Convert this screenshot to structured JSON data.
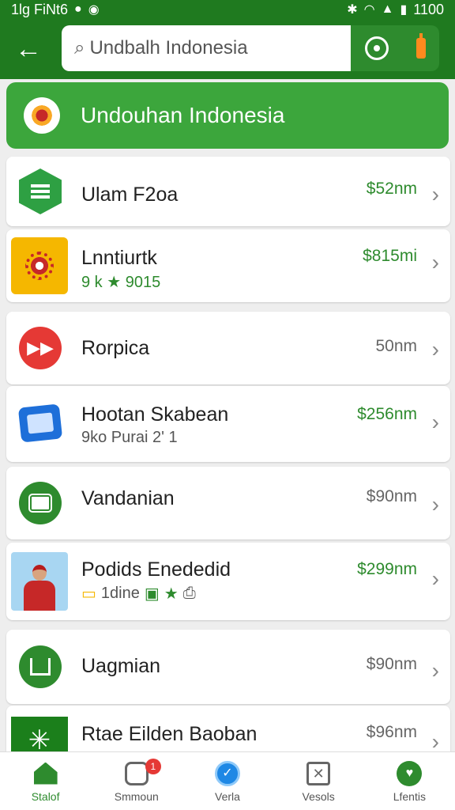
{
  "status_bar": {
    "left_text": "1lg FiNt6",
    "right_text": "1100",
    "icons": [
      "notification-icon",
      "chat-icon",
      "bluetooth-icon",
      "wifi-icon",
      "signal-icon",
      "battery-icon"
    ]
  },
  "app_bar": {
    "back_icon": "arrow-left-icon",
    "search_value": "Undbalh Indonesia",
    "search_icon": "magnifier-icon",
    "actions": [
      "zoom-icon",
      "bolt-icon"
    ]
  },
  "banner": {
    "title": "Undouhan Indonesia",
    "emblem": "garuda-emblem-icon"
  },
  "items": [
    {
      "name": "Ulam F2oa",
      "price": "$52nm",
      "price_color": "green",
      "icon": "list-hexagon-icon"
    },
    {
      "name": "Lnntiurtk",
      "sub": "9 k ★ 9015",
      "price": "$815mi",
      "price_color": "green",
      "icon": "gear-emblem-icon"
    },
    {
      "name": "Rorpica",
      "price": "50nm",
      "price_color": "gray",
      "icon": "play-icon"
    },
    {
      "name": "Hootan Skabean",
      "sub": "9ko Purai 2' 1",
      "price": "$256nm",
      "price_color": "green",
      "icon": "document-icon"
    },
    {
      "name": "Vandanian",
      "price": "$90nm",
      "price_color": "gray",
      "icon": "note-icon"
    },
    {
      "name": "Podids Enededid",
      "sub": "1dine",
      "price": "$299nm",
      "price_color": "green",
      "icon": "avatar-icon"
    },
    {
      "name": "Uagmian",
      "price": "$90nm",
      "price_color": "gray",
      "icon": "frame-icon"
    },
    {
      "name": "Rtae Eilden Baoban",
      "price": "$96nm",
      "price_color": "gray",
      "icon": "sunburst-icon"
    }
  ],
  "bottom_nav": [
    {
      "label": "Stalof",
      "icon": "home-icon",
      "active": true
    },
    {
      "label": "Smmoun",
      "icon": "box-icon",
      "badge": "1"
    },
    {
      "label": "Verla",
      "icon": "check-icon"
    },
    {
      "label": "Vesols",
      "icon": "x-box-icon"
    },
    {
      "label": "Lfentis",
      "icon": "heart-icon"
    }
  ],
  "colors": {
    "primary": "#1f7a1f",
    "accent": "#3ca63c",
    "price_green": "#2e8b2e"
  }
}
